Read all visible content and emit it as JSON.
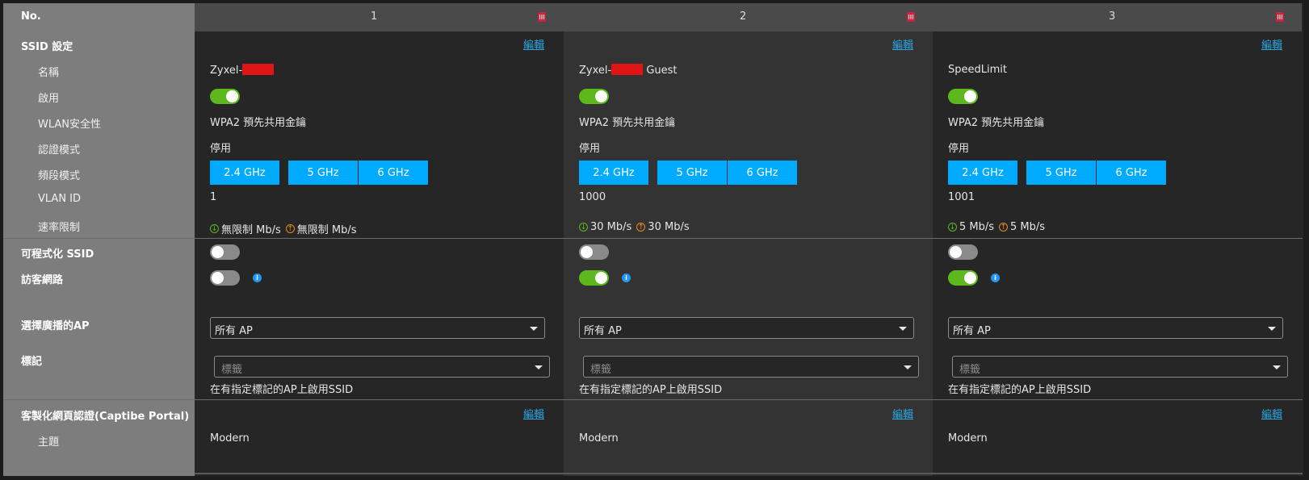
{
  "header": {
    "no_label": "No.",
    "columns": [
      "1",
      "2",
      "3"
    ]
  },
  "labels": {
    "ssid_section": "SSID 設定",
    "name": "名稱",
    "enable": "啟用",
    "wlan_security": "WLAN安全性",
    "auth_mode": "認證模式",
    "band_mode": "頻段模式",
    "vlan_id": "VLAN ID",
    "rate_limit": "速率限制",
    "programmable_ssid": "可程式化 SSID",
    "guest_network": "訪客網路",
    "broadcast_ap": "選擇廣播的AP",
    "tag": "標記",
    "captive_portal": "客製化網頁認證(Captibe Portal)",
    "theme": "主題"
  },
  "edit_label": "編輯",
  "bands": [
    "2.4 GHz",
    "5 GHz",
    "6 GHz"
  ],
  "ssids": [
    {
      "name_prefix": "Zyxel-",
      "name_suffix": "",
      "enabled": true,
      "security": "WPA2 預先共用金鑰",
      "auth": "停用",
      "vlan": "1",
      "rate_down": "無限制 Mb/s",
      "rate_up": "無限制 Mb/s",
      "programmable": false,
      "guest": false,
      "ap": "所有 AP",
      "tag_placeholder": "標籤",
      "tag_hint": "在有指定標記的AP上啟用SSID",
      "theme": "Modern"
    },
    {
      "name_prefix": "Zyxel-",
      "name_suffix": " Guest",
      "enabled": true,
      "security": "WPA2 預先共用金鑰",
      "auth": "停用",
      "vlan": "1000",
      "rate_down": "30 Mb/s",
      "rate_up": "30 Mb/s",
      "programmable": false,
      "guest": true,
      "ap": "所有 AP",
      "tag_placeholder": "標籤",
      "tag_hint": "在有指定標記的AP上啟用SSID",
      "theme": "Modern"
    },
    {
      "name_prefix": "SpeedLimit",
      "name_suffix": "",
      "enabled": true,
      "security": "WPA2 預先共用金鑰",
      "auth": "停用",
      "vlan": "1001",
      "rate_down": "5 Mb/s",
      "rate_up": "5 Mb/s",
      "programmable": false,
      "guest": true,
      "ap": "所有 AP",
      "tag_placeholder": "標籤",
      "tag_hint": "在有指定標記的AP上啟用SSID",
      "theme": "Modern"
    }
  ],
  "colors": {
    "toggle_on": "#5cb81c",
    "toggle_off": "#8a8a8a",
    "band_button": "#00aaff",
    "link": "#2aa5e0",
    "delete": "#d0203a"
  }
}
